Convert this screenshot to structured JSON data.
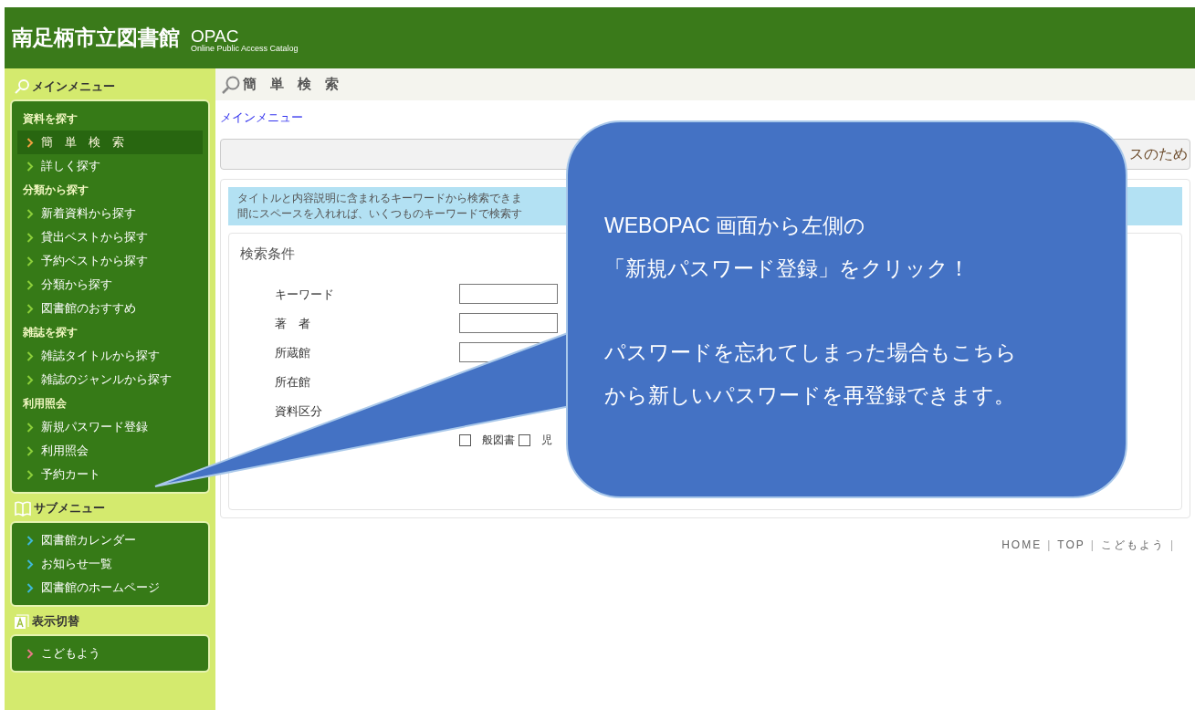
{
  "header": {
    "title": "南足柄市立図書館",
    "logo": "OPAC",
    "logo_sub": "Online Public Access Catalog"
  },
  "sidebar": [
    {
      "heading": "メインメニュー",
      "color": "#8ccf3a",
      "items": [
        {
          "kind": "group",
          "label": "資料を探す"
        },
        {
          "kind": "link",
          "label": "簡　単　検　索",
          "selected": true
        },
        {
          "kind": "link",
          "label": "詳しく探す",
          "selected": false
        },
        {
          "kind": "group",
          "label": "分類から探す"
        },
        {
          "kind": "link",
          "label": "新着資料から探す",
          "selected": false
        },
        {
          "kind": "link",
          "label": "貸出ベストから探す",
          "selected": false
        },
        {
          "kind": "link",
          "label": "予約ベストから探す",
          "selected": false
        },
        {
          "kind": "link",
          "label": "分類から探す",
          "selected": false
        },
        {
          "kind": "link",
          "label": "図書館のおすすめ",
          "selected": false
        },
        {
          "kind": "group",
          "label": "雑誌を探す"
        },
        {
          "kind": "link",
          "label": "雑誌タイトルから探す",
          "selected": false
        },
        {
          "kind": "link",
          "label": "雑誌のジャンルから探す",
          "selected": false
        },
        {
          "kind": "group",
          "label": "利用照会"
        },
        {
          "kind": "link",
          "label": "新規パスワード登録",
          "selected": false
        },
        {
          "kind": "link",
          "label": "利用照会",
          "selected": false
        },
        {
          "kind": "link",
          "label": "予約カート",
          "selected": false
        }
      ]
    },
    {
      "heading": "サブメニュー",
      "color": "#3fb8d8",
      "items": [
        {
          "kind": "link",
          "label": "図書館カレンダー",
          "selected": false
        },
        {
          "kind": "link",
          "label": "お知らせ一覧",
          "selected": false
        },
        {
          "kind": "link",
          "label": "図書館のホームページ",
          "selected": false
        }
      ]
    },
    {
      "heading": "表示切替",
      "color": "#e87a86",
      "items": [
        {
          "kind": "link",
          "label": "こどもよう",
          "selected": false
        }
      ]
    }
  ],
  "page_title": "簡　単　検　索",
  "breadcrumb": "メインメニュー",
  "notice": "スのため",
  "info": [
    "タイトルと内容説明に含まれるキーワードから検索できま",
    "間にスペースを入れれば、いくつものキーワードで検索す"
  ],
  "form": {
    "title": "検索条件",
    "fields": [
      {
        "kind": "text",
        "label": "キーワード"
      },
      {
        "kind": "text",
        "label": "著　者"
      },
      {
        "kind": "text",
        "label": "所蔵館"
      },
      {
        "kind": "label",
        "label": "所在館"
      },
      {
        "kind": "label",
        "label": "資料区分"
      },
      {
        "kind": "checks",
        "options": [
          {
            "label": "般図書",
            "checked": false
          },
          {
            "label": "児",
            "checked": false
          }
        ]
      }
    ]
  },
  "footer_links": [
    {
      "kind": "link",
      "text": "HOME"
    },
    {
      "kind": "separator",
      "text": "|"
    },
    {
      "kind": "link",
      "text": "TOP"
    },
    {
      "kind": "separator",
      "text": "|"
    },
    {
      "kind": "link",
      "text": "こどもよう"
    },
    {
      "kind": "separator",
      "text": "|"
    }
  ],
  "callout": {
    "paragraphs": [
      [
        "WEBOPAC 画面から左側の",
        "「新規パスワード登録」をクリック！"
      ],
      [
        "パスワードを忘れてしまった場合もこちら",
        "から新しいパスワードを再登録できます。"
      ]
    ]
  }
}
